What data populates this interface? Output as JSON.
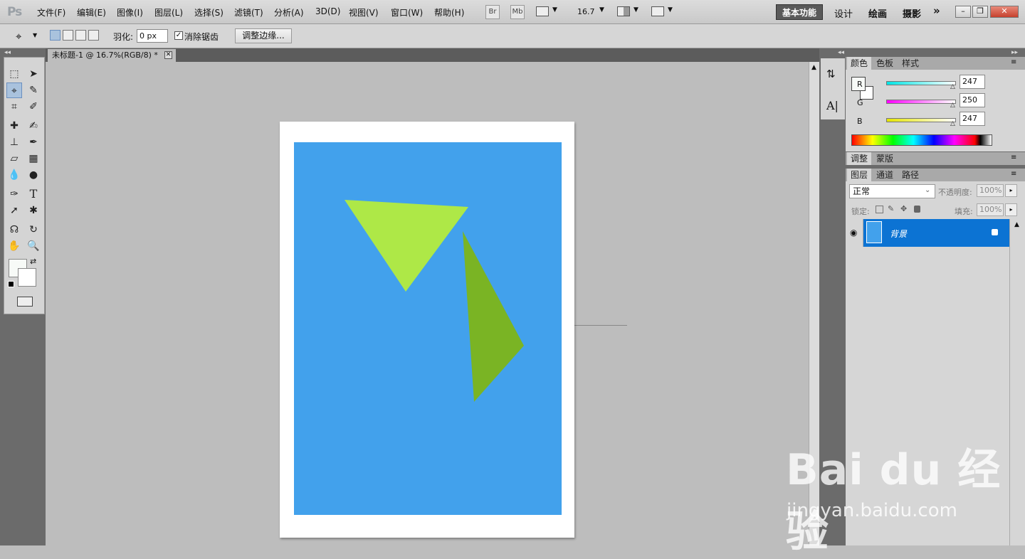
{
  "app": {
    "logo": "Ps"
  },
  "menu": [
    "文件(F)",
    "编辑(E)",
    "图像(I)",
    "图层(L)",
    "选择(S)",
    "滤镜(T)",
    "分析(A)",
    "3D(D)",
    "视图(V)",
    "窗口(W)",
    "帮助(H)"
  ],
  "appbar": {
    "br": "Br",
    "mb": "Mb",
    "zoom": "16.7"
  },
  "workspace": {
    "active": "基本功能",
    "items": [
      "设计",
      "绘画",
      "摄影"
    ],
    "more": "»"
  },
  "window_controls": {
    "min": "–",
    "restore": "❐",
    "close": "✕"
  },
  "options": {
    "feather_label": "羽化:",
    "feather_value": "0 px",
    "antialias_label": "消除锯齿",
    "antialias_checked": true,
    "refine_label": "调整边缘..."
  },
  "document": {
    "tab_title": "未标题-1 @ 16.7%(RGB/8) *",
    "close": "✕",
    "art_color": "#42a1ec",
    "shape1_color": "#aee847",
    "shape2_color": "#7ab424"
  },
  "color_panel": {
    "tabs": [
      "颜色",
      "色板",
      "样式"
    ],
    "channels": [
      {
        "label": "R",
        "value": "247"
      },
      {
        "label": "G",
        "value": "250"
      },
      {
        "label": "B",
        "value": "247"
      }
    ]
  },
  "adjust_panel": {
    "tabs": [
      "调整",
      "蒙版"
    ]
  },
  "layers_panel": {
    "tabs": [
      "图层",
      "通道",
      "路径"
    ],
    "blend_mode": "正常",
    "opacity_label": "不透明度:",
    "opacity_value": "100%",
    "lock_label": "锁定:",
    "fill_label": "填充:",
    "fill_value": "100%",
    "layers": [
      {
        "name": "背景",
        "selected": true,
        "locked": true
      }
    ]
  },
  "watermark": {
    "main": "Bai du 经验",
    "sub": "jingyan.baidu.com"
  }
}
